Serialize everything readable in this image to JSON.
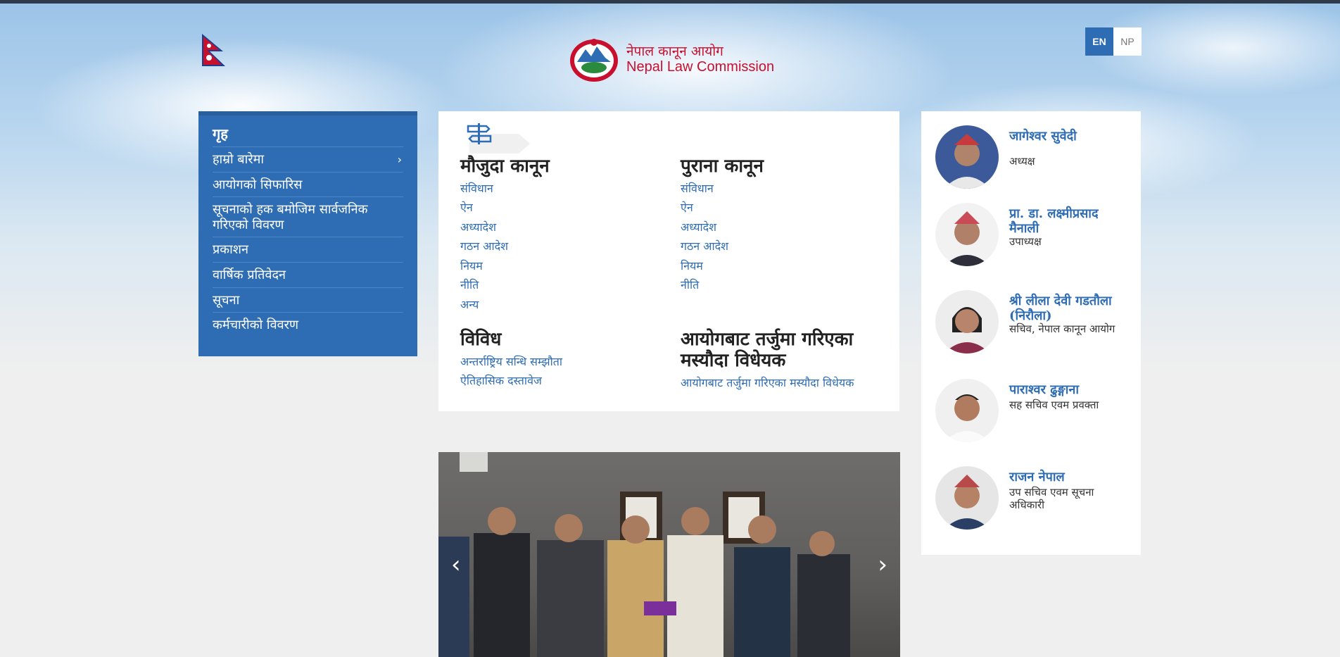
{
  "header": {
    "logo_np": "नेपाल कानून आयोग",
    "logo_en": "Nepal Law Commission",
    "lang_en": "EN",
    "lang_np": "NP"
  },
  "sidebar": {
    "items": [
      {
        "label": "गृह"
      },
      {
        "label": "हाम्रो बारेमा"
      },
      {
        "label": "आयोगको सिफारिस"
      },
      {
        "label": "सूचनाको हक बमोजिम सार्वजनिक गरिएको विवरण"
      },
      {
        "label": "प्रकाशन"
      },
      {
        "label": "वार्षिक प्रतिवेदन"
      },
      {
        "label": "सूचना"
      },
      {
        "label": "कर्मचारीको विवरण"
      }
    ]
  },
  "laws": {
    "current": {
      "title": "मौजुदा कानून",
      "links": [
        "संविधान",
        "ऐन",
        "अध्यादेश",
        "गठन आदेश",
        "नियम",
        "नीति",
        "अन्य"
      ]
    },
    "old": {
      "title": "पुराना कानून",
      "links": [
        "संविधान",
        "ऐन",
        "अध्यादेश",
        "गठन आदेश",
        "नियम",
        "नीति"
      ]
    },
    "misc": {
      "title": "विविध",
      "links": [
        "अन्तर्राष्ट्रिय सन्धि सम्झौता",
        "ऐतिहासिक दस्तावेज"
      ]
    },
    "drafts": {
      "title": "आयोगबाट तर्जुमा गरिएका मस्यौदा विधेयक",
      "links": [
        "आयोगबाट तर्जुमा गरिएका मस्यौदा विधेयक"
      ]
    }
  },
  "slider": {
    "prev": "‹",
    "next": "›"
  },
  "officials": [
    {
      "name": "जागेश्वर सुवेदी",
      "role": "अध्यक्ष"
    },
    {
      "name": "प्रा. डा. लक्ष्मीप्रसाद मैनाली",
      "role": "उपाध्यक्ष"
    },
    {
      "name": "श्री लीला देवी गडतौला (निरौला)",
      "role": "सचिव, नेपाल कानून आयोग"
    },
    {
      "name": "पाराश्वर ढुङ्गाना",
      "role": "सह सचिव एवम प्रवक्ता"
    },
    {
      "name": "राजन नेपाल",
      "role": "उप सचिव एवम सूचना अधिकारी"
    }
  ],
  "colors": {
    "brand_blue": "#2e6db4",
    "logo_red": "#c8102e"
  }
}
